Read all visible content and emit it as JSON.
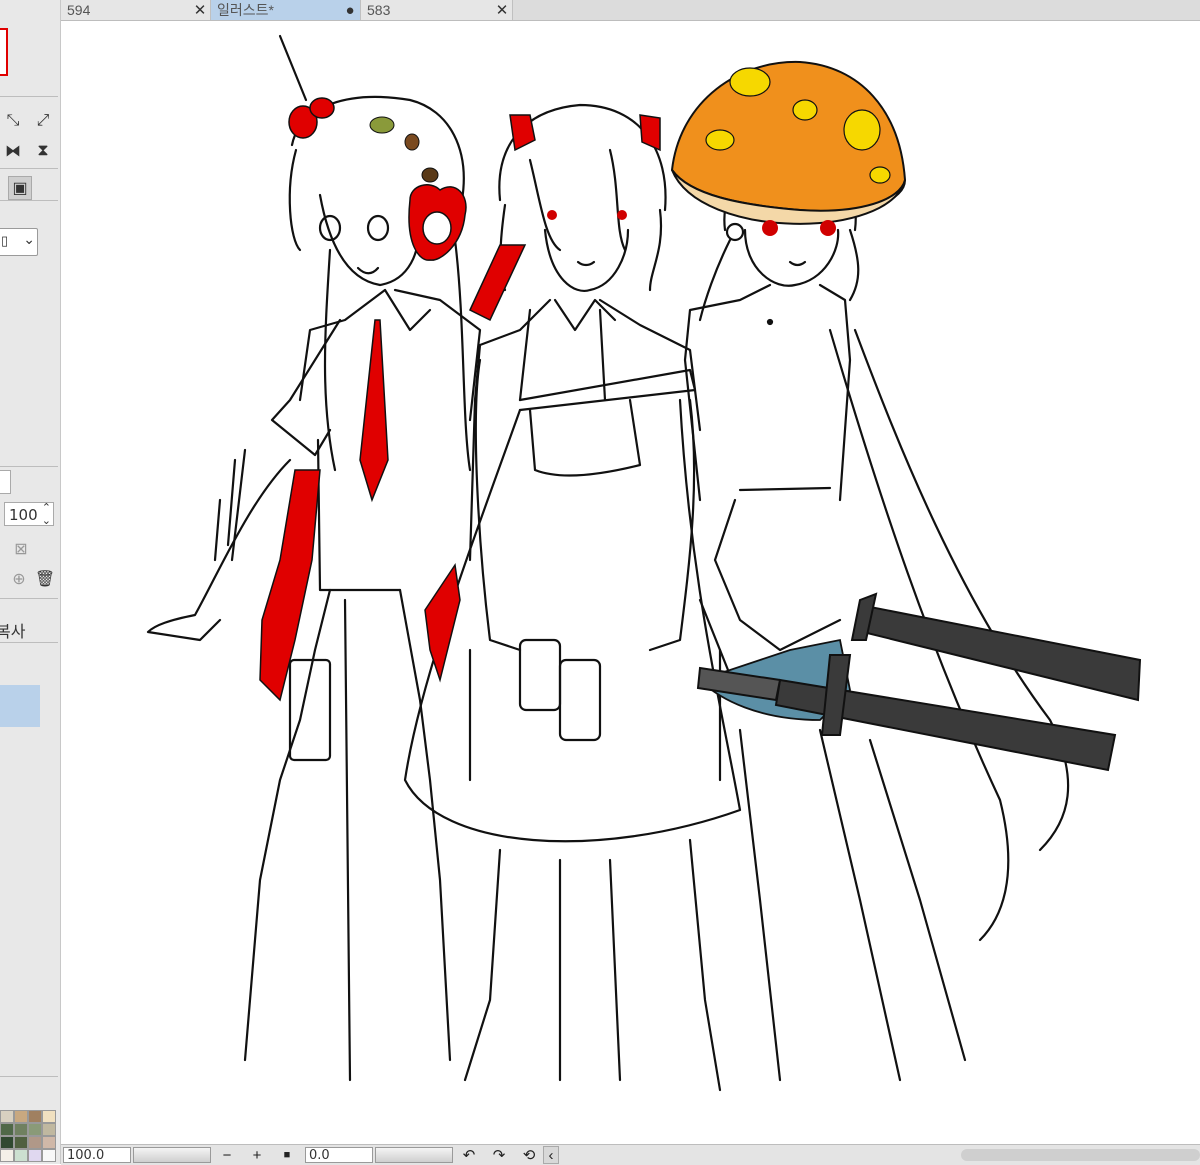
{
  "tabs": [
    {
      "label": "594",
      "close": "✕"
    },
    {
      "label": "일러스트*",
      "close": "●"
    },
    {
      "label": "583",
      "close": "✕"
    }
  ],
  "left_panel": {
    "opacity_value": "100",
    "layer_text": "복사",
    "icons": [
      "expand-icon",
      "fit-icon",
      "flip-horizontal-icon",
      "flip-vertical-icon",
      "layer-comp-icon",
      "dropdown-icon",
      "spinner-icon",
      "mask-icon",
      "new-layer-icon",
      "trash-icon"
    ]
  },
  "status_bar": {
    "zoom_value": "100.0",
    "angle_value": "0.0",
    "zoom_out": "−",
    "zoom_in": "+",
    "stop": "■",
    "rotate_left": "↶",
    "rotate_right": "↷",
    "reset_rotation": "⟲",
    "scroll_left": "‹"
  },
  "palette_colors": [
    "#d8d0c0",
    "#c8a880",
    "#a08060",
    "#f0e0c0",
    "#506848",
    "#708060",
    "#8a9a78",
    "#c0b8a0",
    "#304830",
    "#506040",
    "#b09888",
    "#d0b8a8",
    "#f4f0e8",
    "#cce0d0",
    "#e0d8f0",
    "#f8f8f8"
  ],
  "accent": {
    "tab_active": "#b9d1ea",
    "red": "#e00000",
    "orange": "#f0901c",
    "yellow": "#f6d800",
    "denim": "#5b8fa6",
    "sword": "#3a3a3a"
  }
}
